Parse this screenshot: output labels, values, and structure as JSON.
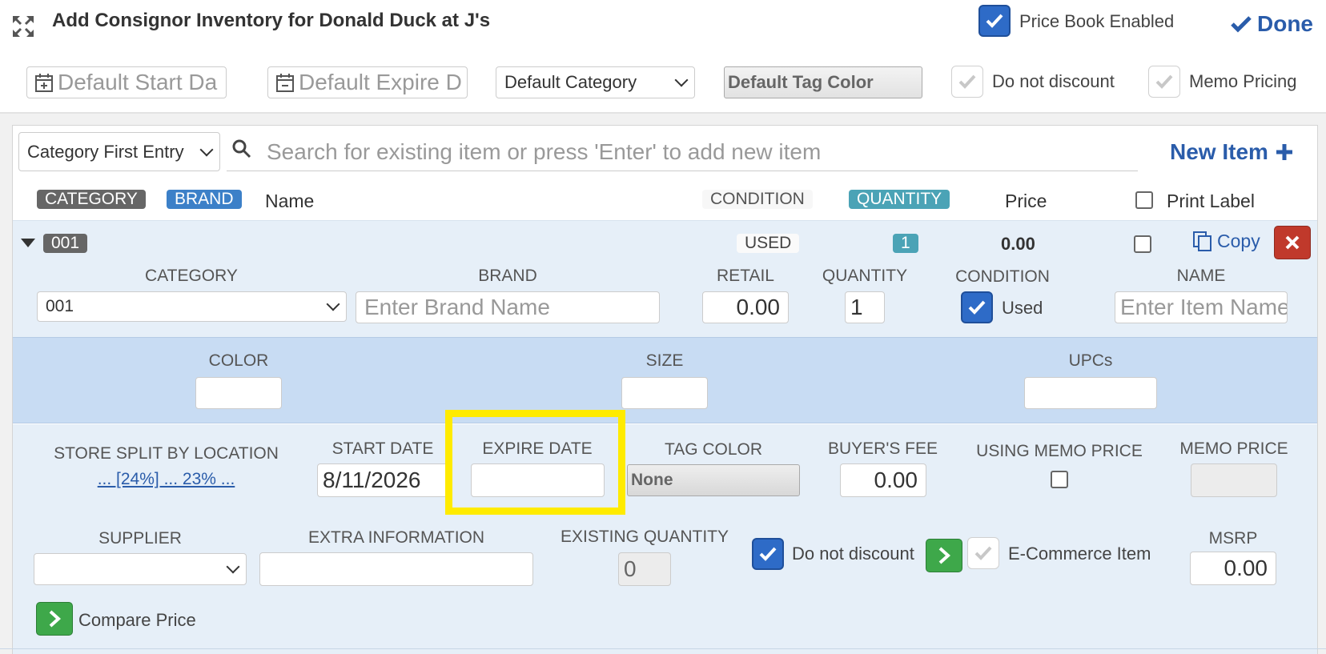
{
  "header": {
    "title": "Add Consignor Inventory for Donald Duck at J's",
    "price_book_label": "Price Book Enabled",
    "done_label": "Done",
    "expand_icon": "expand-arrows-icon"
  },
  "defaults": {
    "start_date_placeholder": "Default Start Da",
    "expire_date_placeholder": "Default Expire D",
    "category_label": "Default Category",
    "tag_color_label": "Default Tag Color",
    "do_not_discount_label": "Do not discount",
    "memo_pricing_label": "Memo Pricing"
  },
  "entry": {
    "mode_label": "Category First Entry",
    "search_placeholder": "Search for existing item or press 'Enter' to add new item",
    "new_item_label": "New Item"
  },
  "columns": {
    "category": "CATEGORY",
    "brand": "BRAND",
    "name": "Name",
    "condition": "CONDITION",
    "quantity": "QUANTITY",
    "price": "Price",
    "print_label": "Print Label"
  },
  "item": {
    "category_badge": "001",
    "condition_badge": "USED",
    "quantity_badge": "1",
    "price": "0.00",
    "copy_label": "Copy",
    "fields": {
      "category_label": "CATEGORY",
      "category_value": "001",
      "brand_label": "BRAND",
      "brand_placeholder": "Enter Brand Name",
      "retail_label": "RETAIL",
      "retail_value": "0.00",
      "quantity_label": "QUANTITY",
      "quantity_value": "1",
      "condition_label": "CONDITION",
      "condition_value": "Used",
      "name_label": "NAME",
      "name_placeholder": "Enter Item Name"
    },
    "attributes": {
      "color_label": "COLOR",
      "size_label": "SIZE",
      "upcs_label": "UPCs"
    },
    "details": {
      "store_split_label": "STORE SPLIT BY LOCATION",
      "store_split_value": "... [24%] ... 23% ...",
      "start_date_label": "START DATE",
      "start_date_value": "8/11/2026",
      "expire_date_label": "EXPIRE DATE",
      "tag_color_label": "TAG COLOR",
      "tag_color_value": "None",
      "buyers_fee_label": "BUYER'S FEE",
      "buyers_fee_value": "0.00",
      "using_memo_label": "USING MEMO PRICE",
      "memo_price_label": "MEMO PRICE",
      "supplier_label": "SUPPLIER",
      "extra_info_label": "EXTRA INFORMATION",
      "existing_qty_label": "EXISTING QUANTITY",
      "existing_qty_value": "0",
      "do_not_discount_label": "Do not discount",
      "ecommerce_label": "E-Commerce Item",
      "msrp_label": "MSRP",
      "msrp_value": "0.00",
      "compare_price_label": "Compare Price"
    }
  },
  "colors": {
    "accent_blue": "#2e6bc7",
    "link_blue": "#2a5caa",
    "highlight_yellow": "#ffeb00",
    "danger_red": "#c0392b",
    "success_green": "#3ea84a",
    "info_teal": "#4ba3b6"
  }
}
